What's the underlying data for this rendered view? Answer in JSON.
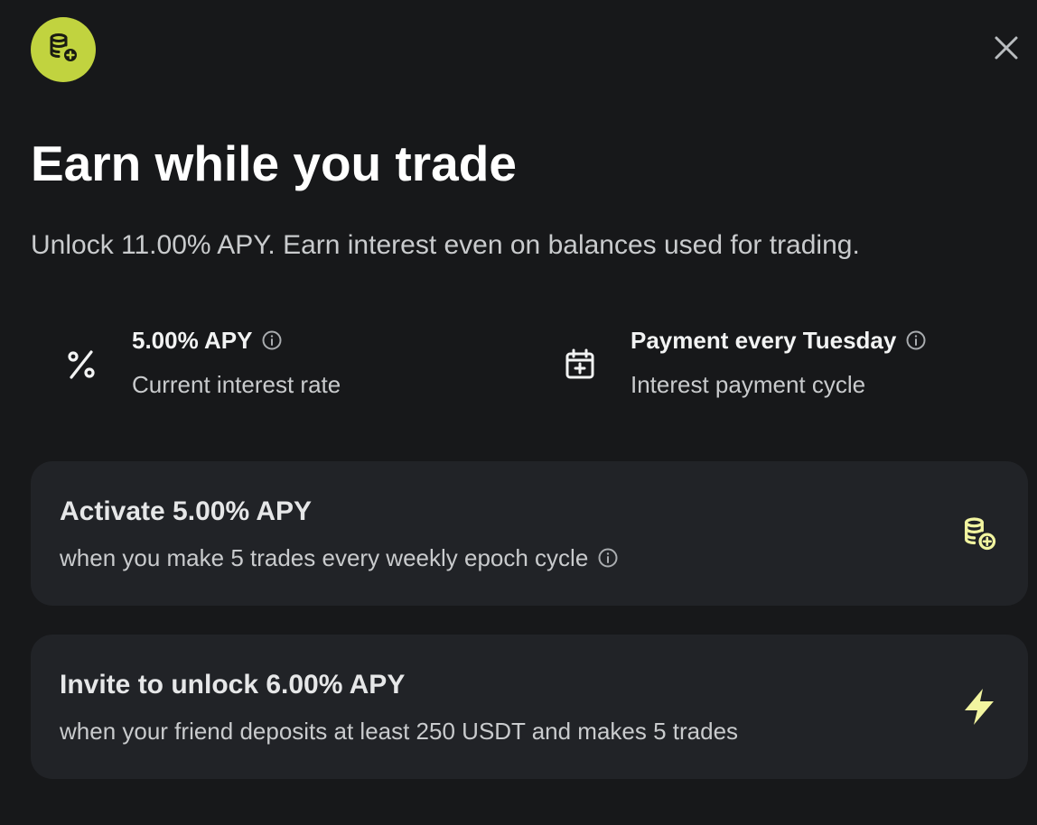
{
  "header": {
    "title": "Earn while you trade",
    "subtitle": "Unlock 11.00% APY. Earn interest even on balances used for trading.",
    "badge_icon": "coins-plus-icon",
    "close_icon": "close-icon"
  },
  "stats": [
    {
      "icon": "percent-icon",
      "value": "5.00% APY",
      "label": "Current interest rate"
    },
    {
      "icon": "calendar-plus-icon",
      "value": "Payment every Tuesday",
      "label": "Interest payment cycle"
    }
  ],
  "cards": [
    {
      "title": "Activate 5.00% APY",
      "subtitle": "when you make 5 trades every weekly epoch cycle",
      "icon": "coins-plus-icon"
    },
    {
      "title": "Invite to unlock 6.00% APY",
      "subtitle": "when your friend deposits at least 250 USDT and makes 5 trades",
      "icon": "lightning-icon"
    }
  ],
  "colors": {
    "background": "#17181a",
    "card": "#212327",
    "accent": "#c1d33f",
    "icon_accent": "#f2f5a0",
    "text": "#f2f3f3",
    "muted": "#c9cbcd"
  }
}
